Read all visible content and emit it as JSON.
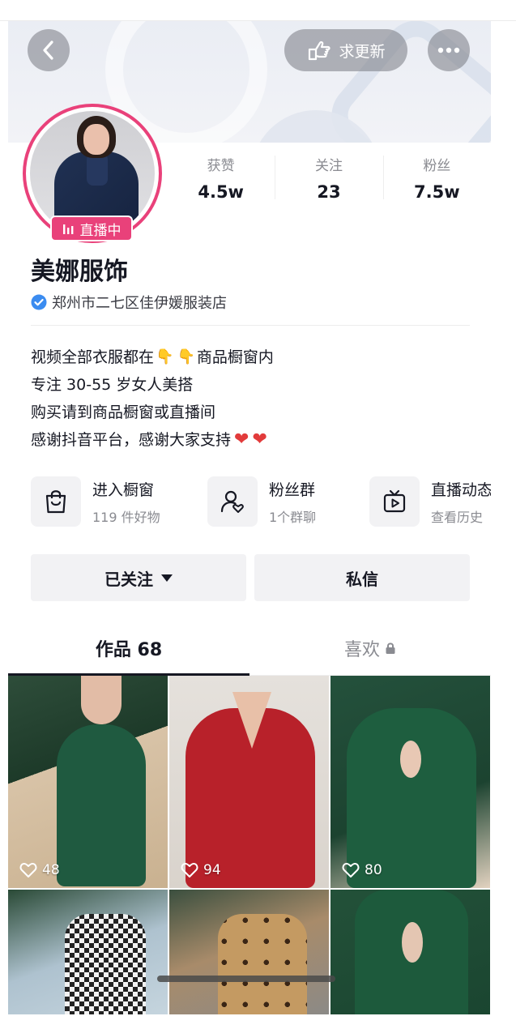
{
  "header": {
    "request_update_label": "求更新"
  },
  "profile": {
    "live_badge": "直播中",
    "name": "美娜服饰",
    "verified_text": "郑州市二七区佳伊媛服装店",
    "stats": [
      {
        "label": "获赞",
        "value": "4.5w"
      },
      {
        "label": "关注",
        "value": "23"
      },
      {
        "label": "粉丝",
        "value": "7.5w"
      }
    ],
    "bio": {
      "line1_a": "视频全部衣服都在",
      "line1_b": "商品橱窗内",
      "line2": "专注 30-55 岁女人美搭",
      "line3": "购买请到商品橱窗或直播间",
      "line4": "感谢抖音平台，感谢大家支持"
    }
  },
  "cards": [
    {
      "title": "进入橱窗",
      "sub": "119 件好物",
      "icon": "shopping-bag-icon"
    },
    {
      "title": "粉丝群",
      "sub": "1个群聊",
      "icon": "fan-group-icon"
    },
    {
      "title": "直播动态",
      "sub": "查看历史",
      "icon": "tv-play-icon"
    }
  ],
  "actions": {
    "follow_label": "已关注",
    "message_label": "私信"
  },
  "tabs": {
    "works_label": "作品 68",
    "likes_label": "喜欢"
  },
  "grid": {
    "likes": [
      "48",
      "94",
      "80"
    ]
  },
  "colors": {
    "live_pink": "#e9417a",
    "verify_blue": "#3b8cf0",
    "text_primary": "#161823",
    "text_secondary": "#8a8b91"
  }
}
